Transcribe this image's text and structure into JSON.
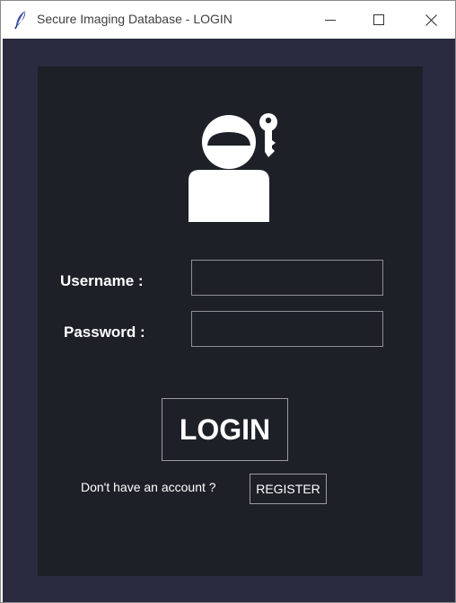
{
  "window": {
    "title": "Secure Imaging Database - LOGIN"
  },
  "titlebar_controls": {
    "minimize_icon": "minimize-icon",
    "maximize_icon": "maximize-icon",
    "close_icon": "close-icon"
  },
  "login_form": {
    "header_icon": "user-key-icon",
    "username_label": "Username :",
    "username_value": "",
    "password_label": "Password :",
    "password_value": "",
    "login_button": "LOGIN"
  },
  "register_prompt": {
    "text": "Don't have an account ?",
    "register_button": "REGISTER"
  },
  "colors": {
    "client_background": "#2a2a40",
    "panel_background": "#1e2028",
    "text": "#ffffff",
    "field_border": "#8e8e96"
  }
}
